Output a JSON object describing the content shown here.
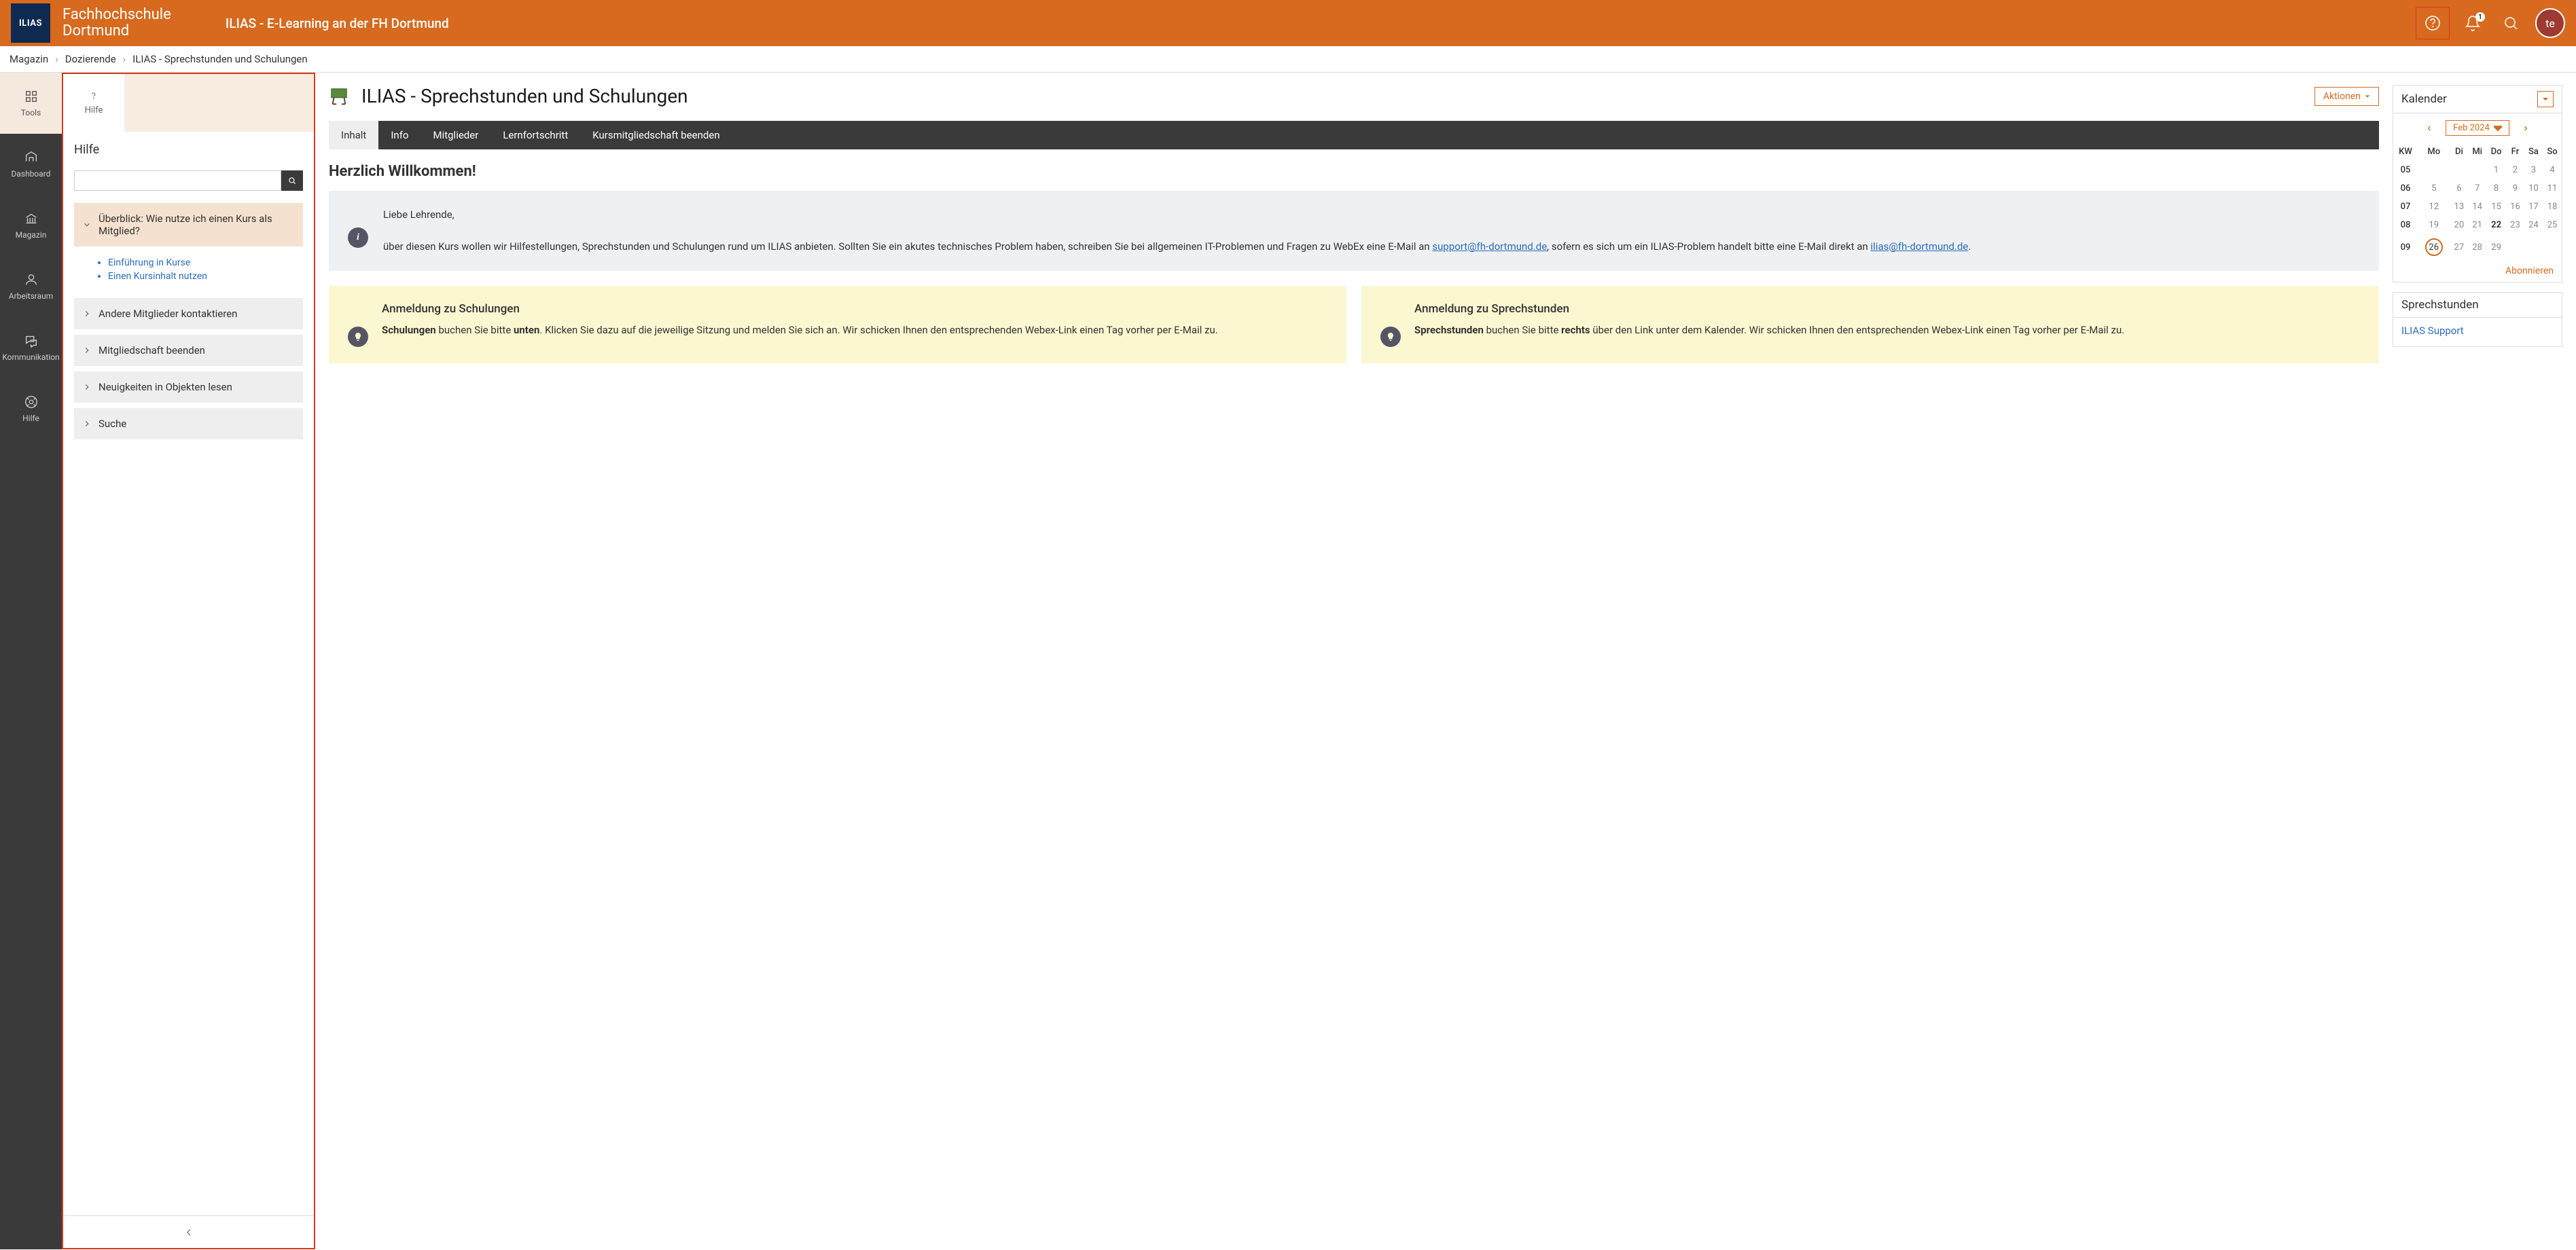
{
  "header": {
    "logo": "ILIAS",
    "institution_line1": "Fachhochschule",
    "institution_line2": "Dortmund",
    "product": "ILIAS - E-Learning an der FH Dortmund",
    "notification_count": "1",
    "avatar": "te"
  },
  "breadcrumb": {
    "items": [
      "Magazin",
      "Dozierende",
      "ILIAS - Sprechstunden und Schulungen"
    ]
  },
  "leftnav": {
    "items": [
      {
        "label": "Tools"
      },
      {
        "label": "Dashboard"
      },
      {
        "label": "Magazin"
      },
      {
        "label": "Arbeitsraum"
      },
      {
        "label": "Kommunikation"
      },
      {
        "label": "Hilfe"
      }
    ]
  },
  "help_panel": {
    "tab_label": "Hilfe",
    "title": "Hilfe",
    "topics": [
      {
        "label": "Überblick: Wie nutze ich einen Kurs als Mitglied?",
        "expanded": true,
        "links": [
          "Einführung in Kurse",
          "Einen Kursinhalt nutzen"
        ]
      },
      {
        "label": "Andere Mitglieder kontaktieren"
      },
      {
        "label": "Mitgliedschaft beenden"
      },
      {
        "label": "Neuigkeiten in Objekten lesen"
      },
      {
        "label": "Suche"
      }
    ]
  },
  "page": {
    "title": "ILIAS - Sprechstunden und Schulungen",
    "actions": "Aktionen",
    "tabs": [
      "Inhalt",
      "Info",
      "Mitglieder",
      "Lernfortschritt",
      "Kursmitgliedschaft beenden"
    ],
    "welcome": "Herzlich Willkommen!",
    "info_salutation": "Liebe Lehrende,",
    "info_body_pre": "über diesen Kurs wollen wir Hilfestellungen, Sprechstunden und Schulungen rund um ILIAS anbieten. Sollten Sie ein akutes technisches Problem haben, schreiben Sie bei allgemeinen IT-Problemen und Fragen zu WebEx eine E-Mail an ",
    "info_email1": "support@fh-dortmund.de",
    "info_body_mid": ", sofern es sich um ein ILIAS-Problem handelt bitte eine E-Mail direkt an ",
    "info_email2": "ilias@fh-dortmund.de",
    "info_body_end": ".",
    "cards": [
      {
        "title": "Anmeldung zu Schulungen",
        "b1": "Schulungen",
        "mid1": " buchen Sie bitte ",
        "b2": "unten",
        "rest": ". Klicken Sie dazu auf die jeweilige Sitzung und melden Sie sich an. Wir schicken Ihnen den entsprechenden Webex-Link einen Tag vorher per E-Mail zu."
      },
      {
        "title": "Anmeldung zu Sprechstunden",
        "b1": "Sprechstunden",
        "mid1": " buchen Sie bitte ",
        "b2": "rechts",
        "rest": " über den Link unter dem Kalender. Wir schicken Ihnen den entsprechenden Webex-Link einen Tag vorher per E-Mail zu."
      }
    ]
  },
  "calendar": {
    "title": "Kalender",
    "month": "Feb 2024",
    "headers": [
      "KW",
      "Mo",
      "Di",
      "Mi",
      "Do",
      "Fr",
      "Sa",
      "So"
    ],
    "rows": [
      {
        "kw": "05",
        "days": [
          "",
          "",
          "",
          "1",
          "2",
          "3",
          "4"
        ]
      },
      {
        "kw": "06",
        "days": [
          "5",
          "6",
          "7",
          "8",
          "9",
          "10",
          "11"
        ]
      },
      {
        "kw": "07",
        "days": [
          "12",
          "13",
          "14",
          "15",
          "16",
          "17",
          "18"
        ]
      },
      {
        "kw": "08",
        "days": [
          "19",
          "20",
          "21",
          "22",
          "23",
          "24",
          "25"
        ]
      },
      {
        "kw": "09",
        "days": [
          "26",
          "27",
          "28",
          "29",
          "",
          "",
          ""
        ]
      }
    ],
    "bold_days": [
      "22"
    ],
    "today": "26",
    "subscribe": "Abonnieren"
  },
  "office_hours": {
    "title": "Sprechstunden",
    "link": "ILIAS Support"
  }
}
